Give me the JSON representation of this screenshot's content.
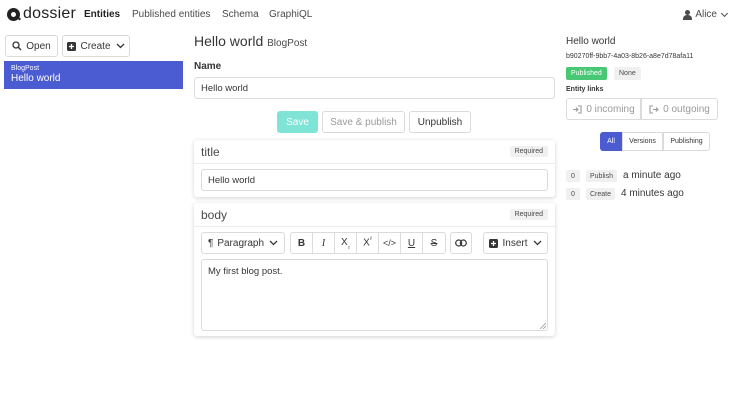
{
  "nav": {
    "logo": "dossier",
    "items": [
      "Entities",
      "Published entities",
      "Schema",
      "GraphiQL"
    ],
    "user": "Alice"
  },
  "sidebar": {
    "open_label": "Open",
    "create_label": "Create",
    "entities": [
      {
        "type": "BlogPost",
        "title": "Hello world"
      }
    ]
  },
  "editor": {
    "title": "Hello world",
    "type": "BlogPost",
    "name_label": "Name",
    "name_value": "Hello world",
    "save_label": "Save",
    "save_publish_label": "Save & publish",
    "unpublish_label": "Unpublish",
    "fields": [
      {
        "name": "title",
        "required": "Required",
        "value": "Hello world"
      },
      {
        "name": "body",
        "required": "Required",
        "value": "My first blog post."
      }
    ],
    "toolbar": {
      "paragraph_label": "Paragraph",
      "insert_label": "Insert"
    }
  },
  "details": {
    "title": "Hello world",
    "id": "b90270ff-9bb7-4a03-8b26-a8e7d78afa11",
    "status": "Published",
    "validity": "None",
    "links_label": "Entity links",
    "incoming": "0 incoming",
    "outgoing": "0 outgoing",
    "tabs": [
      "All",
      "Versions",
      "Publishing"
    ],
    "history": [
      {
        "version": "0",
        "event": "Publish",
        "time": "a minute ago"
      },
      {
        "version": "0",
        "event": "Create",
        "time": "4 minutes ago"
      }
    ]
  },
  "colors": {
    "accent": "#4b5bd1",
    "published": "#48c774",
    "save_disabled": "#7fe3d6"
  }
}
